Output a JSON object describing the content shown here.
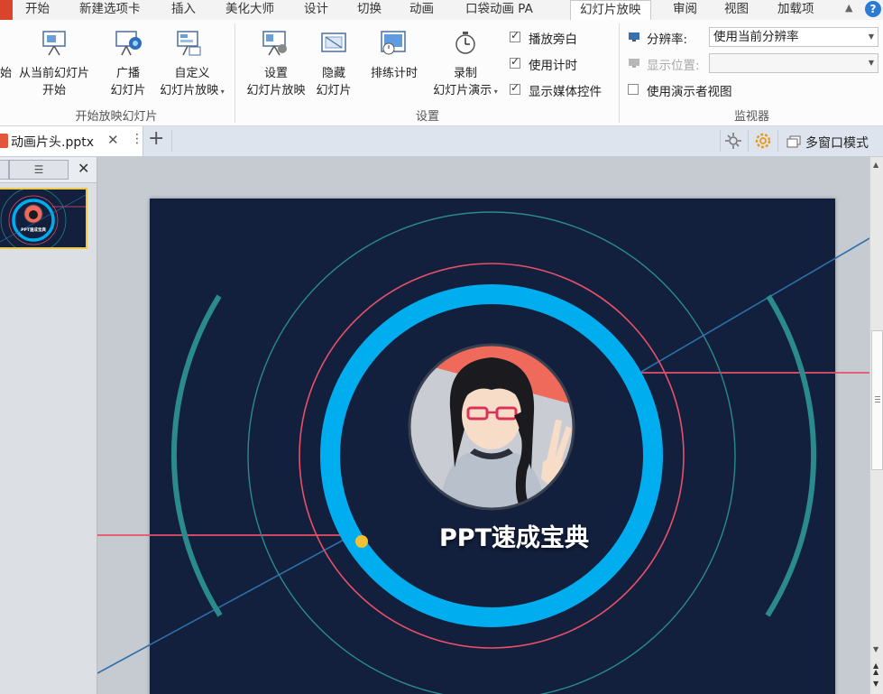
{
  "tabs": [
    "开始",
    "新建选项卡",
    "插入",
    "美化大师",
    "设计",
    "切换",
    "动画",
    "口袋动画 PA",
    "幻灯片放映",
    "审阅",
    "视图",
    "加载项"
  ],
  "active_tab": "幻灯片放映",
  "ribbon": {
    "from_start_label": "始",
    "from_current_line1": "从当前幻灯片",
    "from_current_line2": "开始",
    "broadcast_line1": "广播",
    "broadcast_line2": "幻灯片",
    "custom_line1": "自定义",
    "custom_line2": "幻灯片放映",
    "group_start": "开始放映幻灯片",
    "setup_line1": "设置",
    "setup_line2": "幻灯片放映",
    "hide_line1": "隐藏",
    "hide_line2": "幻灯片",
    "rehearse_label": "排练计时",
    "record_line1": "录制",
    "record_line2": "幻灯片演示",
    "chk_narration": "播放旁白",
    "chk_timings": "使用计时",
    "chk_media": "显示媒体控件",
    "group_setup": "设置",
    "resolution_label": "分辨率:",
    "resolution_value": "使用当前分辨率",
    "show_on_label": "显示位置:",
    "presenter_view": "使用演示者视图",
    "group_monitors": "监视器"
  },
  "doc": {
    "tab_name": "动画片头.pptx",
    "close": "✕",
    "more": "⋮",
    "add": "+",
    "multiwindow": "多窗口模式"
  },
  "slide": {
    "title": "PPT速成宝典",
    "thumb_title": "PPT速成宝典"
  },
  "colors": {
    "slide_bg": "#121f3d",
    "ring_blue": "#00aeef",
    "ring_red": "#e8506a",
    "ring_teal": "#2a8a8e",
    "dot_yellow": "#f2c037",
    "avatar_bg": "#ef6a5a"
  },
  "icons": [
    "presentation-icon",
    "broadcast-icon",
    "custom-show-icon",
    "setup-show-icon",
    "hide-slide-icon",
    "rehearse-icon",
    "record-icon",
    "monitor-icon",
    "settings-icon",
    "gear-icon",
    "window-icon",
    "help-icon",
    "collapse-icon"
  ]
}
